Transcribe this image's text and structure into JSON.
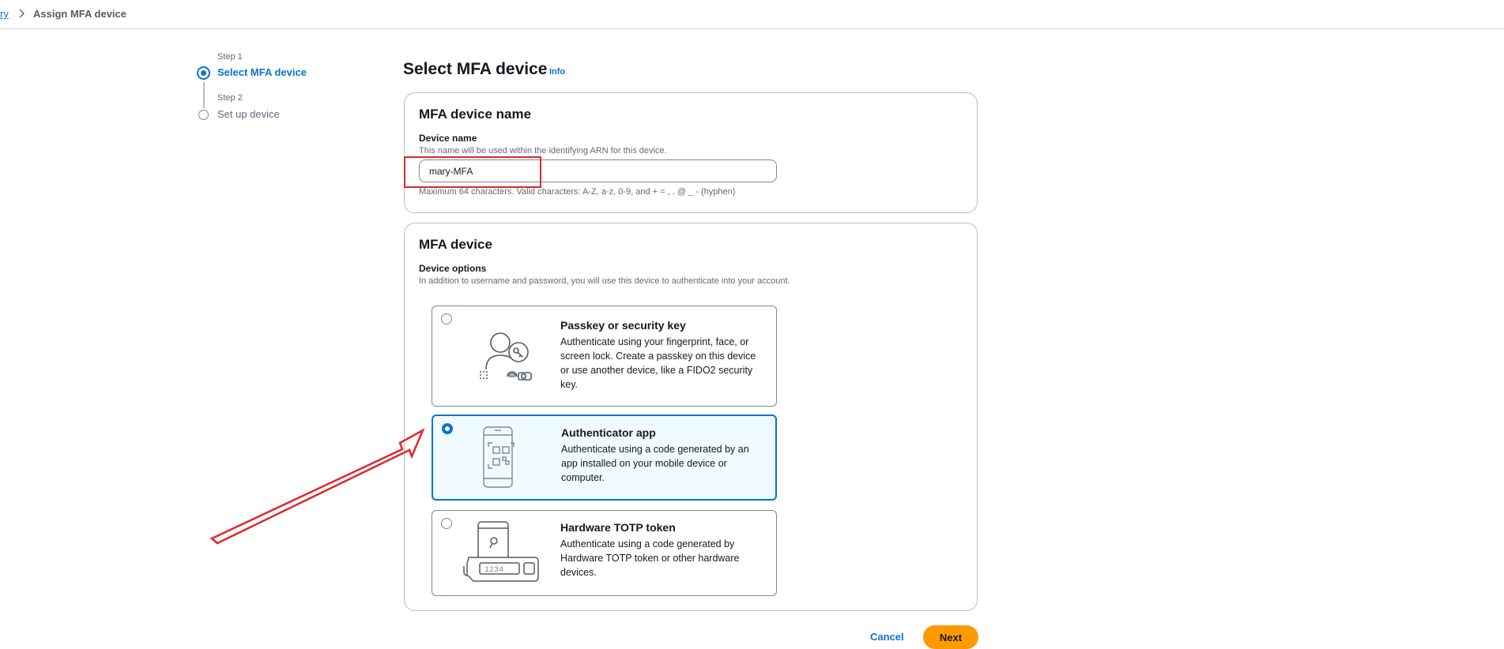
{
  "breadcrumb": {
    "parent_label": "ry",
    "current_label": "Assign MFA device"
  },
  "steps": [
    {
      "label": "Step 1",
      "title": "Select MFA device",
      "state": "active"
    },
    {
      "label": "Step 2",
      "title": "Set up device",
      "state": "inactive"
    }
  ],
  "page": {
    "title": "Select MFA device",
    "info_label": "Info"
  },
  "device_name_panel": {
    "title": "MFA device name",
    "field_label": "Device name",
    "field_description": "This name will be used within the identifying ARN for this device.",
    "value": "mary-MFA",
    "constraint_text": "Maximum 64 characters. Valid characters: A-Z, a-z, 0-9, and + = , . @ _ - (hyphen)"
  },
  "device_panel": {
    "title": "MFA device",
    "options_label": "Device options",
    "options_description": "In addition to username and password, you will use this device to authenticate into your account.",
    "options": [
      {
        "title": "Passkey or security key",
        "description": "Authenticate using your fingerprint, face, or screen lock. Create a passkey on this device or use another device, like a FIDO2 security key.",
        "selected": false,
        "icon": "passkey-icon"
      },
      {
        "title": "Authenticator app",
        "description": "Authenticate using a code generated by an app installed on your mobile device or computer.",
        "selected": true,
        "icon": "authenticator-app-icon"
      },
      {
        "title": "Hardware TOTP token",
        "description": "Authenticate using a code generated by Hardware TOTP token or other hardware devices.",
        "selected": false,
        "icon": "hardware-token-icon",
        "token_code": "1234"
      }
    ]
  },
  "footer": {
    "cancel_label": "Cancel",
    "next_label": "Next"
  },
  "colors": {
    "accent": "#0972d3",
    "primary_button": "#ff9900",
    "annotation": "#e0262b"
  }
}
